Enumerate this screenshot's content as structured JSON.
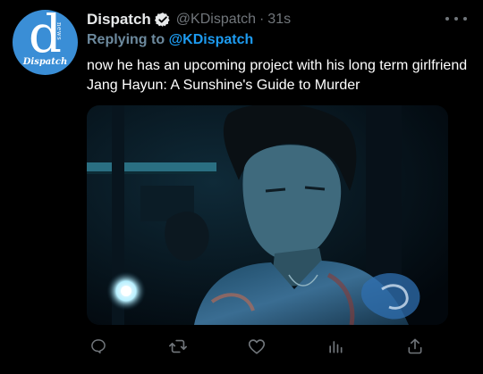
{
  "tweet": {
    "avatar": {
      "letter": "d",
      "side_text": "news",
      "brand": "Dispatch"
    },
    "author": {
      "name": "Dispatch",
      "handle": "@KDispatch",
      "separator": "·",
      "time": "31s"
    },
    "reply": {
      "prefix": "Replying to ",
      "mention": "@KDispatch"
    },
    "text": "now he has an upcoming project with his long term girlfriend Jang Hayun: A Sunshine's Guide to Murder",
    "media": {
      "alt": ""
    },
    "actions": [
      {
        "name": "reply",
        "icon": "comment-icon"
      },
      {
        "name": "retweet",
        "icon": "retweet-icon"
      },
      {
        "name": "like",
        "icon": "heart-icon"
      },
      {
        "name": "views",
        "icon": "analytics-icon"
      },
      {
        "name": "share",
        "icon": "share-icon"
      }
    ]
  },
  "colors": {
    "background": "#000000",
    "text": "#ffffff",
    "muted": "#71767b",
    "link": "#1d9bf0",
    "avatar_blue": "#3a8ed6"
  }
}
